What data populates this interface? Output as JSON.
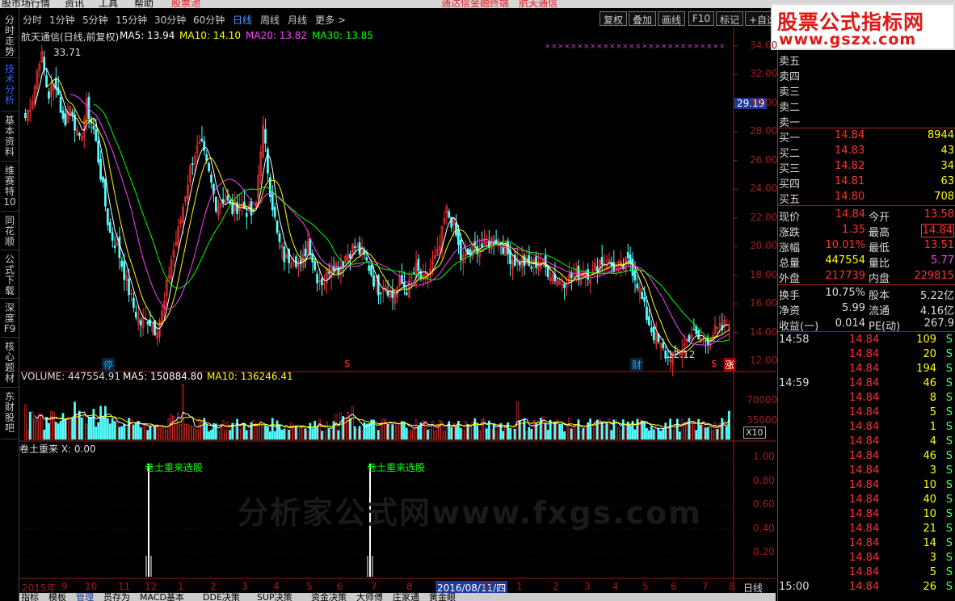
{
  "app": {
    "menu": [
      "股市场行情",
      "资讯",
      "工具",
      "帮助",
      "股票池",
      "通达信金融终端",
      "航天通信"
    ]
  },
  "sidebar": [
    "分时走势",
    "技术分析",
    "基本资料",
    "维赛特10",
    "同花顺",
    "公式下载",
    "深度F9",
    "核心题材",
    "东财股吧"
  ],
  "periods": [
    "分时",
    "1分钟",
    "5分钟",
    "15分钟",
    "30分钟",
    "60分钟",
    "日线",
    "周线",
    "月线",
    "更多 >"
  ],
  "toolbar": [
    "复权",
    "叠加",
    "画线",
    "F10",
    "标记",
    "+自选"
  ],
  "logo": {
    "line1": "股票公式指标网",
    "line2": "www.gszx.com"
  },
  "main_legend": {
    "title": "航天通信(日线,前复权)",
    "ma5": "MA5: 13.94",
    "ma10": "MA10: 14.10",
    "ma20": "MA20: 13.82",
    "ma30": "MA30: 13.85"
  },
  "vol_legend": {
    "title": "VOLUME: 447554.91",
    "ma5": "MA5: 150884.80",
    "ma10": "MA10: 136246.41"
  },
  "ind_legend": {
    "title": "卷土重来 X: 0.00"
  },
  "signal_label": "卷土重来选股",
  "watermark": "分析家公式网www.fxgs.com",
  "annotations": {
    "high": "33.71",
    "low": "12.12",
    "ting": "停",
    "cai": "财",
    "dollar": "$",
    "zhang": "涨",
    "x10": "X10",
    "cross_price": "29.19"
  },
  "axis": {
    "price": [
      "34.00",
      "32.00",
      "30.00",
      "28.00",
      "26.00",
      "24.00",
      "22.00",
      "20.00",
      "18.00",
      "16.00",
      "14.00",
      "12.00"
    ],
    "volume": [
      "70000",
      "35000"
    ],
    "indicator": [
      "1.00",
      "0.80",
      "0.60",
      "0.40",
      "0.20"
    ],
    "dates": [
      "2015年",
      "9",
      "10",
      "11",
      "12",
      "1",
      "2",
      "3",
      "4",
      "5",
      "6",
      "7",
      "8",
      "2016/08/11/四",
      "12",
      "1",
      "2",
      "3",
      "4",
      "5",
      "6",
      "7",
      "8"
    ],
    "period": "日线"
  },
  "chart_data": {
    "type": "line",
    "title": "航天通信(日线,前复权)",
    "price_range": [
      11.5,
      34.5
    ],
    "close_path": [
      29.0,
      30.5,
      33.7,
      30.5,
      31.5,
      28.5,
      30.0,
      27.0,
      29.8,
      28.0,
      24.5,
      21.0,
      20.0,
      18.0,
      16.0,
      14.6,
      15.0,
      14.2,
      15.5,
      19.0,
      21.0,
      24.0,
      26.5,
      27.0,
      25.0,
      22.8,
      23.5,
      22.5,
      23.0,
      22.5,
      22.0,
      28.5,
      24.0,
      20.5,
      19.0,
      19.5,
      18.5,
      20.5,
      18.0,
      17.5,
      19.0,
      18.5,
      19.5,
      20.0,
      19.5,
      18.5,
      17.0,
      17.5,
      16.5,
      17.5,
      17.0,
      18.5,
      17.5,
      18.5,
      19.5,
      22.5,
      21.5,
      19.0,
      19.5,
      20.0,
      20.0,
      20.5,
      20.5,
      19.5,
      19.0,
      19.0,
      18.5,
      19.0,
      18.5,
      18.0,
      17.5,
      17.8,
      18.0,
      18.5,
      18.0,
      19.0,
      19.0,
      18.5,
      18.5,
      19.0,
      17.5,
      15.5,
      14.0,
      13.0,
      12.2,
      12.5,
      13.0,
      14.0,
      13.5,
      13.5,
      14.0,
      14.2,
      14.84
    ],
    "signals_index": [
      0.18,
      0.49
    ],
    "volume_max": 90000
  },
  "quote": {
    "asks": [
      {
        "label": "卖五"
      },
      {
        "label": "卖四"
      },
      {
        "label": "卖三"
      },
      {
        "label": "卖二"
      },
      {
        "label": "卖一"
      }
    ],
    "bids": [
      {
        "label": "买一",
        "price": "14.84",
        "vol": "8944"
      },
      {
        "label": "买二",
        "price": "14.83",
        "vol": "43"
      },
      {
        "label": "买三",
        "price": "14.82",
        "vol": "34"
      },
      {
        "label": "买四",
        "price": "14.81",
        "vol": "63"
      },
      {
        "label": "买五",
        "price": "14.80",
        "vol": "708"
      }
    ],
    "stats": [
      {
        "l1": "现价",
        "v1": "14.84",
        "l2": "今开",
        "v2": "13.58"
      },
      {
        "l1": "涨跌",
        "v1": "1.35",
        "l2": "最高",
        "v2": "14.84"
      },
      {
        "l1": "涨幅",
        "v1": "10.01%",
        "l2": "最低",
        "v2": "13.51"
      },
      {
        "l1": "总量",
        "v1": "447554",
        "l2": "量比",
        "v2": "5.77"
      },
      {
        "l1": "外盘",
        "v1": "217739",
        "l2": "内盘",
        "v2": "229815"
      }
    ],
    "finance": [
      {
        "l1": "换手",
        "v1": "10.75%",
        "l2": "股本",
        "v2": "5.22亿"
      },
      {
        "l1": "净资",
        "v1": "5.99",
        "l2": "流通",
        "v2": "4.16亿"
      },
      {
        "l1": "收益(一)",
        "v1": "0.014",
        "l2": "PE(动)",
        "v2": "267.9"
      }
    ],
    "ticks": [
      {
        "t": "14:58",
        "p": "14.84",
        "v": "109",
        "s": "S"
      },
      {
        "t": "",
        "p": "14.84",
        "v": "20",
        "s": "S"
      },
      {
        "t": "",
        "p": "14.84",
        "v": "194",
        "s": "S"
      },
      {
        "t": "14:59",
        "p": "14.84",
        "v": "46",
        "s": "S"
      },
      {
        "t": "",
        "p": "14.84",
        "v": "8",
        "s": "S"
      },
      {
        "t": "",
        "p": "14.84",
        "v": "5",
        "s": "S"
      },
      {
        "t": "",
        "p": "14.84",
        "v": "1",
        "s": "S"
      },
      {
        "t": "",
        "p": "14.84",
        "v": "4",
        "s": "S"
      },
      {
        "t": "",
        "p": "14.84",
        "v": "46",
        "s": "S"
      },
      {
        "t": "",
        "p": "14.84",
        "v": "3",
        "s": "S"
      },
      {
        "t": "",
        "p": "14.84",
        "v": "10",
        "s": "S"
      },
      {
        "t": "",
        "p": "14.84",
        "v": "40",
        "s": "S"
      },
      {
        "t": "",
        "p": "14.84",
        "v": "10",
        "s": "S"
      },
      {
        "t": "",
        "p": "14.84",
        "v": "21",
        "s": "S"
      },
      {
        "t": "",
        "p": "14.84",
        "v": "14",
        "s": "S"
      },
      {
        "t": "",
        "p": "14.84",
        "v": "3",
        "s": "S"
      },
      {
        "t": "",
        "p": "14.84",
        "v": "5",
        "s": "S"
      },
      {
        "t": "15:00",
        "p": "14.84",
        "v": "26",
        "s": "S"
      }
    ]
  },
  "bottom_tabs": [
    "指标",
    "模板",
    "管理",
    "员存为",
    "MACD基本",
    "DDE决策",
    "SUP决策",
    "资金决策",
    "大师傅",
    "庄家通",
    "黄金眼"
  ],
  "colors": {
    "up": "#ff3232",
    "down": "#54ffff",
    "ma5": "#ffffff",
    "ma10": "#ffff00",
    "ma20": "#ff40ff",
    "ma30": "#00ff00",
    "signal": "#00ff00",
    "axis": "#a01c1c"
  }
}
